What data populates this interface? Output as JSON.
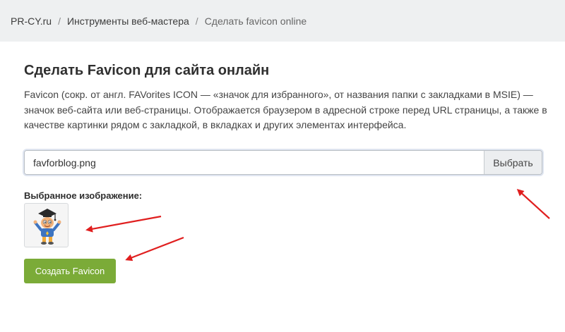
{
  "breadcrumb": {
    "items": [
      "PR-CY.ru",
      "Инструменты веб-мастера"
    ],
    "separator": "/",
    "current": "Сделать favicon online"
  },
  "main": {
    "title": "Сделать Favicon для сайта онлайн",
    "description": "Favicon (сокр. от англ. FAVorites ICON — «значок для избранного», от названия папки с закладками в MSIE) — значок веб-сайта или веб-страницы. Отображается браузером в адресной строке перед URL страницы, а также в качестве картинки рядом с закладкой, в вкладках и других элементах интерфейса."
  },
  "file_picker": {
    "value": "favforblog.png",
    "browse_label": "Выбрать"
  },
  "selected_image": {
    "label": "Выбранное изображение:"
  },
  "actions": {
    "create_label": "Создать Favicon"
  },
  "colors": {
    "accent_green": "#7bab38",
    "annotation_arrow": "#e01f1f"
  }
}
